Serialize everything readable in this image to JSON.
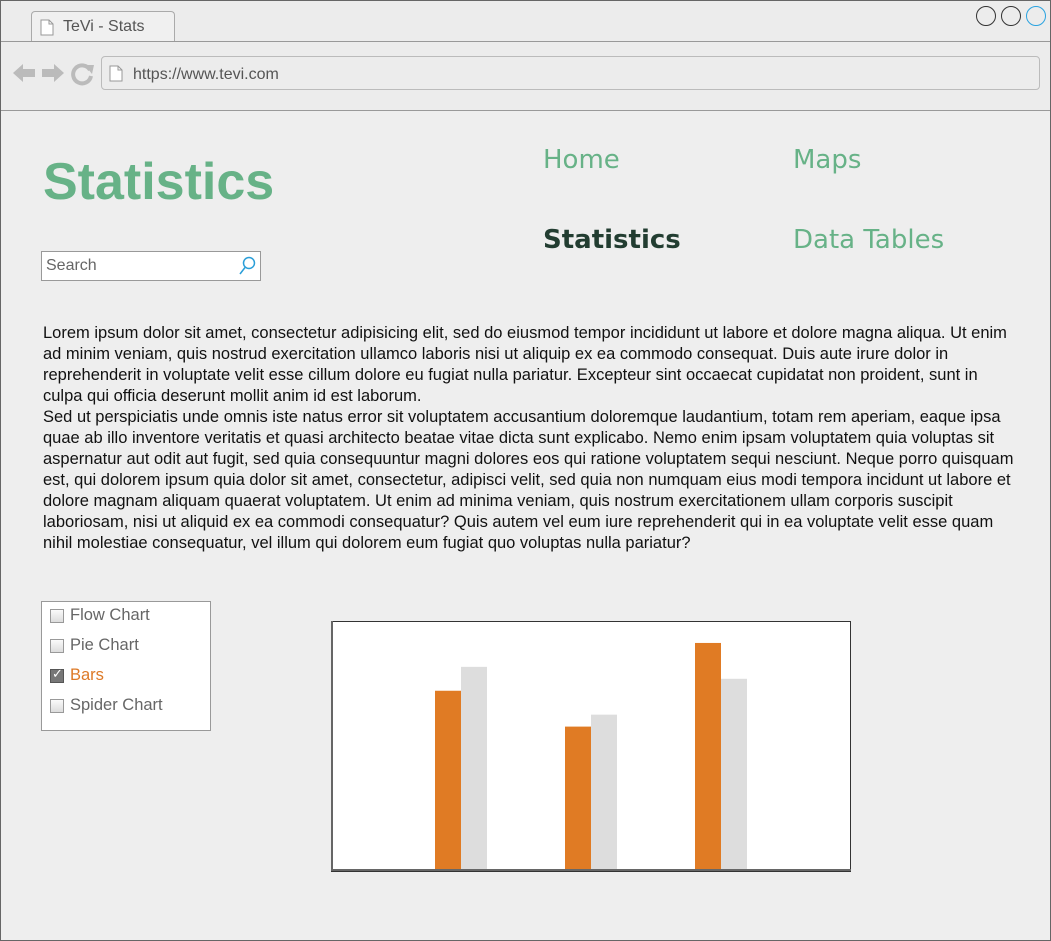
{
  "browser": {
    "tab_title": "TeVi - Stats",
    "url": "https://www.tevi.com",
    "window_buttons": [
      "minimize",
      "maximize",
      "close"
    ],
    "colors": {
      "close_button": "#2aa3e0"
    }
  },
  "page": {
    "heading": "Statistics",
    "nav": [
      {
        "label": "Home",
        "active": false
      },
      {
        "label": "Maps",
        "active": false
      },
      {
        "label": "Statistics",
        "active": true
      },
      {
        "label": "Data Tables",
        "active": false
      }
    ],
    "search": {
      "placeholder": "Search",
      "value": ""
    },
    "paragraphs": [
      "Lorem ipsum dolor sit amet, consectetur adipisicing elit, sed do eiusmod tempor incididunt ut labore et dolore magna aliqua. Ut enim ad minim veniam, quis nostrud exercitation ullamco laboris nisi ut aliquip ex ea commodo consequat. Duis aute irure dolor in reprehenderit in voluptate velit esse cillum dolore eu fugiat nulla pariatur. Excepteur sint occaecat cupidatat non proident, sunt in culpa qui officia deserunt mollit anim id est laborum.",
      "Sed ut perspiciatis unde omnis iste natus error sit voluptatem accusantium doloremque laudantium, totam rem aperiam, eaque ipsa quae ab illo inventore veritatis et quasi architecto beatae vitae dicta sunt explicabo. Nemo enim ipsam voluptatem quia voluptas sit aspernatur aut odit aut fugit, sed quia consequuntur magni dolores eos qui ratione voluptatem sequi nesciunt. Neque porro quisquam est, qui dolorem ipsum quia dolor sit amet, consectetur, adipisci velit, sed quia non numquam eius modi tempora incidunt ut labore et dolore magnam aliquam quaerat voluptatem. Ut enim ad minima veniam, quis nostrum exercitationem ullam corporis suscipit laboriosam, nisi ut aliquid ex ea commodi consequatur? Quis autem vel eum iure reprehenderit qui in ea voluptate velit esse quam nihil molestiae consequatur, vel illum qui dolorem eum fugiat quo voluptas nulla pariatur?"
    ],
    "chart_types": [
      {
        "label": "Flow Chart",
        "checked": false
      },
      {
        "label": "Pie Chart",
        "checked": false
      },
      {
        "label": "Bars",
        "checked": true
      },
      {
        "label": "Spider Chart",
        "checked": false
      }
    ],
    "colors": {
      "accent_green": "#67b287",
      "active_nav": "#223d31",
      "checked_orange": "#dd7926"
    }
  },
  "chart_data": {
    "type": "bar",
    "categories": [
      "",
      "",
      ""
    ],
    "series": [
      {
        "values": [
          75,
          60,
          95
        ],
        "color": "#e07b24"
      },
      {
        "values": [
          85,
          65,
          80
        ],
        "color": "#dddddd"
      }
    ],
    "ylim": [
      0,
      100
    ],
    "grid": false,
    "legend": "none",
    "title": "",
    "xlabel": "",
    "ylabel": ""
  }
}
